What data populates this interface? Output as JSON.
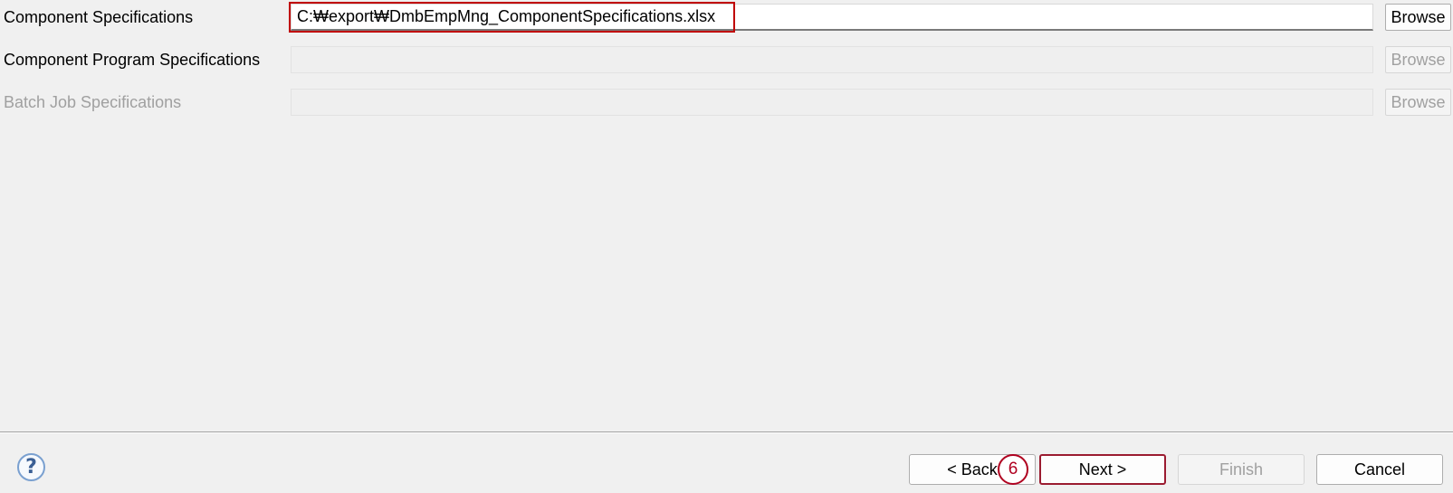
{
  "rows": [
    {
      "label": "Component Specifications",
      "value": "C:₩export₩DmbEmpMng_ComponentSpecifications.xlsx",
      "browse_label": "Browse",
      "enabled": true
    },
    {
      "label": "Component Program Specifications",
      "value": "",
      "browse_label": "Browse",
      "enabled": false
    },
    {
      "label": "Batch Job Specifications",
      "value": "",
      "browse_label": "Browse",
      "enabled": false
    }
  ],
  "footer": {
    "help_glyph": "?",
    "back_label": "< Back",
    "next_label": "Next >",
    "finish_label": "Finish",
    "cancel_label": "Cancel",
    "step_marker": "6"
  },
  "colors": {
    "highlight": "#c00000",
    "step_marker": "#b00020",
    "background": "#f0f0f0"
  }
}
